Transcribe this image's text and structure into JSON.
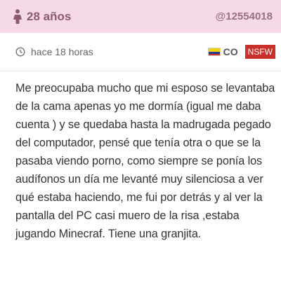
{
  "header": {
    "age": "28 años",
    "user_id": "@12554018",
    "gender_icon": "female-icon"
  },
  "meta": {
    "time": "hace 18 horas",
    "time_icon": "clock-icon",
    "country_code": "CO",
    "flag_icon": "colombia-flag-icon",
    "badge": "NSFW"
  },
  "story": {
    "text": "Me preocupaba mucho que mi esposo se levantaba de la cama apenas yo me dormía (igual me daba cuenta ) y se quedaba hasta la madrugada pegado del computador, pensé que tenía otra o que se la pasaba viendo porno, como siempre se ponía los audífonos un día me levanté muy silenciosa a ver qué estaba haciendo, me fui por detrás y al ver la pantalla del PC casi muero de la risa ,estaba jugando Minecraf. Tiene una granjita."
  },
  "colors": {
    "header_bg": "#f6d9e6",
    "accent": "#8c5a70",
    "nsfw_bg": "#c9302c"
  }
}
